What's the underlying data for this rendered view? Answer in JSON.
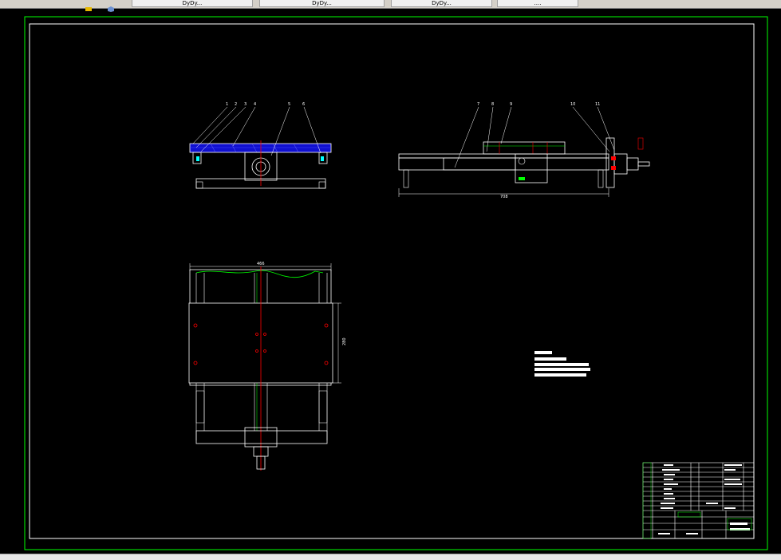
{
  "toolbar": {
    "tabs": [
      {
        "label": "DyDy..."
      },
      {
        "label": "DyDy..."
      },
      {
        "label": "DyDy..."
      },
      {
        "label": "...."
      }
    ]
  },
  "drawing": {
    "front_view_balloons": [
      "1",
      "2",
      "3",
      "4",
      "5",
      "6"
    ],
    "side_view_balloons": [
      "7",
      "8",
      "9",
      "10",
      "11"
    ],
    "dimensions": {
      "side_length": "708",
      "plan_width": "466",
      "plan_height": "280"
    },
    "colors": {
      "frame": "#00ff00",
      "outline": "#ffffff",
      "center_line": "#ff0000",
      "hatch": "#0000ff",
      "accent": "#00ff00"
    }
  }
}
